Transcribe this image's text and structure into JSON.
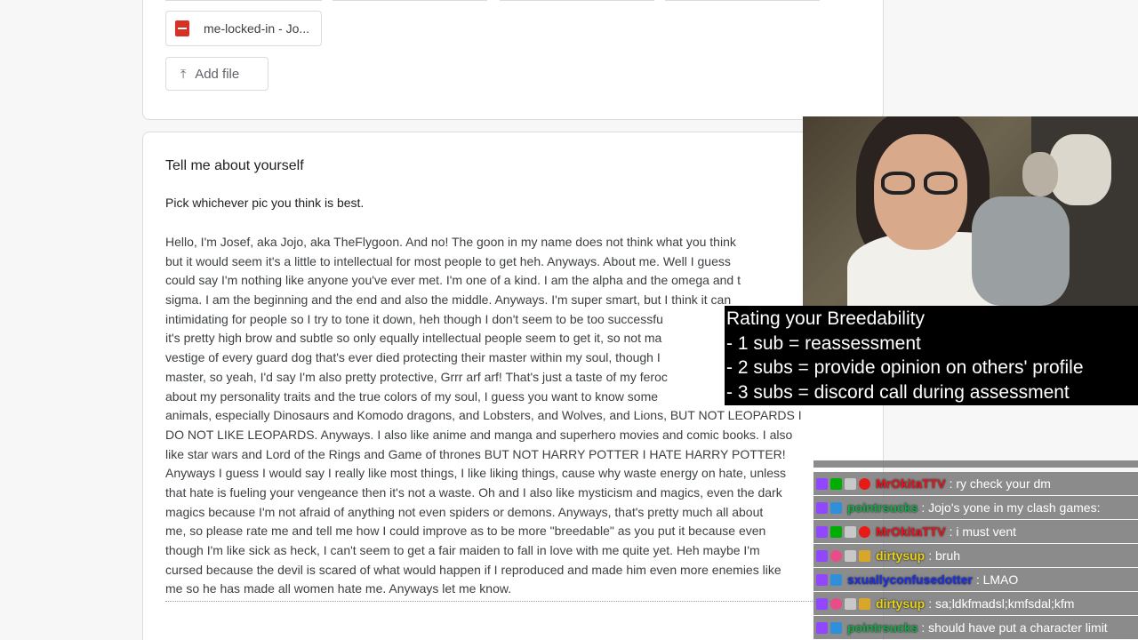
{
  "top_card": {
    "file_name": "me-locked-in - Jo...",
    "add_file_label": "Add file"
  },
  "question": {
    "title": "Tell me about yourself",
    "description": "Pick whichever pic you think is best.",
    "answer_lines": [
      "Hello, I'm Josef, aka Jojo, aka TheFlygoon. And no! The goon in my name does not think what you think",
      "but it would seem it's a little to intellectual for most people to get heh. Anyways. About me. Well I guess",
      "could say I'm nothing like anyone you've ever met. I'm one of a kind. I am the alpha and the omega and t",
      "sigma. I am the beginning and the end and also the middle. Anyways.  I'm super smart, but I think it can",
      "intimidating for people so I try to tone it down, heh though I don't seem to be too successfu",
      "it's pretty high brow and subtle so only equally intellectual people seem to get it, so not ma",
      "vestige of every guard dog that's ever died protecting their master within my soul, though I",
      "master, so yeah, I'd say I'm also pretty protective, Grrr arf arf! That's just a taste of my feroc",
      "about my personality traits and the true colors of my soul, I guess you want to know some",
      "animals, especially Dinosaurs and Komodo dragons, and Lobsters, and Wolves, and Lions, BUT NOT LEOPARDS I",
      "DO NOT LIKE LEOPARDS. Anyways. I also like anime and manga and superhero movies and comic books. I also",
      "like star wars and Lord of the Rings and Game of thrones BUT NOT HARRY POTTER I HATE HARRY POTTER!",
      "Anyways I guess I would say I really like most things, I like liking things, cause why waste energy on hate, unless",
      "that hate is fueling your vengeance then it's not a waste. Oh and I also like mysticism and magics, even the dark",
      "magics because I'm not afraid of anything not even spiders or demons. Anyways, that's pretty much all about",
      "me, so please rate me and tell me how I could improve as to be more \"breedable\" as you put it because even",
      "though I'm like sick as heck, I can't seem to get a fair maiden to fall in love with me quite yet. Heh maybe I'm",
      "cursed because the devil is scared of what would happen if I reproduced and made him even more enemies like",
      "me so he has made all women hate me. Anyways let me know."
    ]
  },
  "overlay": {
    "lines": [
      "Rating your Breedability",
      "- 1 sub = reassessment",
      "- 2 subs = provide opinion on others' profile",
      "- 3 subs = discord call during assessment"
    ]
  },
  "chat": {
    "messages": [
      {
        "user": "MrOkitaTTV",
        "color": "#e8141e",
        "badges": [
          "sub",
          "mod",
          "gray",
          "heart"
        ],
        "text": ": ry check your dm"
      },
      {
        "user": "pointrsucks",
        "color": "#16a84a",
        "badges": [
          "sub",
          "blue"
        ],
        "text": ": Jojo's yone in my clash games:"
      },
      {
        "user": "MrOkitaTTV",
        "color": "#e8141e",
        "badges": [
          "sub",
          "mod",
          "gray",
          "heart"
        ],
        "text": ": i must vent"
      },
      {
        "user": "dirtysup",
        "color": "#e8d21a",
        "badges": [
          "sub",
          "pink",
          "gray",
          "gift"
        ],
        "text": ": bruh"
      },
      {
        "user": "sxuallyconfusedotter",
        "color": "#1a2fe8",
        "badges": [
          "sub",
          "blue"
        ],
        "text": ": LMAO"
      },
      {
        "user": "dirtysup",
        "color": "#e8d21a",
        "badges": [
          "sub",
          "pink",
          "gray",
          "gift"
        ],
        "text": ": sa;ldkfmadsl;kmfsdal;kfm"
      },
      {
        "user": "pointrsucks",
        "color": "#16a84a",
        "badges": [
          "sub",
          "blue"
        ],
        "text": ": should have put a character limit"
      }
    ]
  }
}
